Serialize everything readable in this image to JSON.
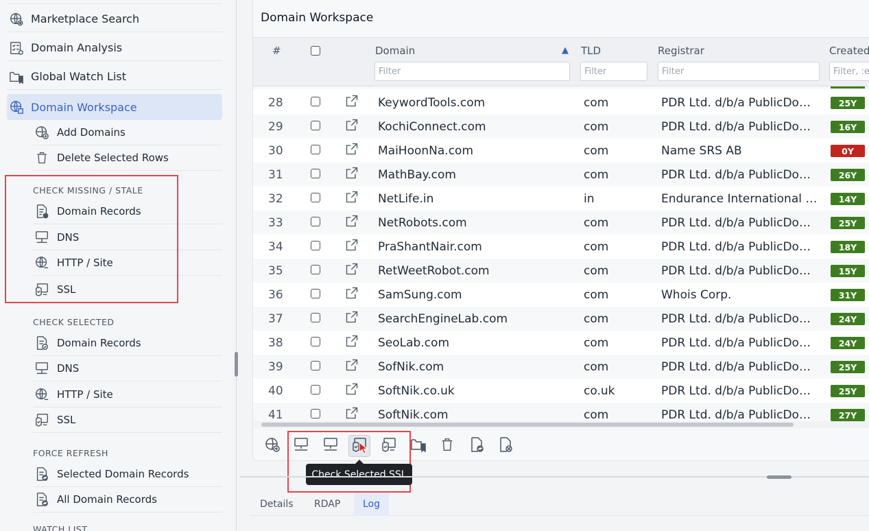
{
  "sidebar": {
    "top_items": [
      {
        "label": "Marketplace Search",
        "icon": "globe-gear-icon"
      },
      {
        "label": "Domain Analysis",
        "icon": "checklist-icon"
      },
      {
        "label": "Global Watch List",
        "icon": "folder-bookmark-icon"
      },
      {
        "label": "Domain Workspace",
        "icon": "globe-grid-icon",
        "active": true
      }
    ],
    "workspace_items": [
      {
        "label": "Add Domains",
        "icon": "globe-plus-icon"
      },
      {
        "label": "Delete Selected Rows",
        "icon": "trash-icon"
      }
    ],
    "check_missing": {
      "heading": "CHECK MISSING / STALE",
      "items": [
        {
          "label": "Domain Records",
          "icon": "document-badge-icon"
        },
        {
          "label": "DNS",
          "icon": "network-icon"
        },
        {
          "label": "HTTP / Site",
          "icon": "globe-link-icon"
        },
        {
          "label": "SSL",
          "icon": "certificate-shield-icon"
        }
      ]
    },
    "check_selected": {
      "heading": "CHECK SELECTED",
      "items": [
        {
          "label": "Domain Records",
          "icon": "document-check-icon"
        },
        {
          "label": "DNS",
          "icon": "network-icon"
        },
        {
          "label": "HTTP / Site",
          "icon": "globe-link-icon"
        },
        {
          "label": "SSL",
          "icon": "certificate-shield-icon"
        }
      ]
    },
    "force_refresh": {
      "heading": "FORCE REFRESH",
      "items": [
        {
          "label": "Selected Domain Records",
          "icon": "document-refresh-icon"
        },
        {
          "label": "All Domain Records",
          "icon": "document-refresh-icon"
        }
      ]
    },
    "next_heading": "WATCH LIST"
  },
  "workspace": {
    "title": "Domain Workspace",
    "columns": {
      "num": "#",
      "domain": "Domain",
      "sort_indicator": "▲",
      "tld": "TLD",
      "registrar": "Registrar",
      "created": "Created"
    },
    "filters": {
      "domain": "Filter",
      "tld": "Filter",
      "registrar": "Filter",
      "created": "Filter, :e"
    },
    "rows": [
      {
        "num": "28",
        "domain": "KeywordTools.com",
        "tld": "com",
        "registrar": "PDR Ltd. d/b/a PublicDomainRegistry.com",
        "age": "25Y",
        "age_color": "#3e7d1f"
      },
      {
        "num": "29",
        "domain": "KochiConnect.com",
        "tld": "com",
        "registrar": "PDR Ltd. d/b/a PublicDomainRegistry.com",
        "age": "16Y",
        "age_color": "#3e7d1f"
      },
      {
        "num": "30",
        "domain": "MaiHoonNa.com",
        "tld": "com",
        "registrar": "Name SRS AB",
        "age": "0Y",
        "age_color": "#c0261d"
      },
      {
        "num": "31",
        "domain": "MathBay.com",
        "tld": "com",
        "registrar": "PDR Ltd. d/b/a PublicDomainRegistry.com",
        "age": "26Y",
        "age_color": "#3e7d1f"
      },
      {
        "num": "32",
        "domain": "NetLife.in",
        "tld": "in",
        "registrar": "Endurance International Group",
        "age": "14Y",
        "age_color": "#3e7d1f"
      },
      {
        "num": "33",
        "domain": "NetRobots.com",
        "tld": "com",
        "registrar": "PDR Ltd. d/b/a PublicDomainRegistry.com",
        "age": "25Y",
        "age_color": "#3e7d1f"
      },
      {
        "num": "34",
        "domain": "PraShantNair.com",
        "tld": "com",
        "registrar": "PDR Ltd. d/b/a PublicDomainRegistry.com",
        "age": "18Y",
        "age_color": "#3e7d1f"
      },
      {
        "num": "35",
        "domain": "RetWeetRobot.com",
        "tld": "com",
        "registrar": "PDR Ltd. d/b/a PublicDomainRegistry.com",
        "age": "15Y",
        "age_color": "#3e7d1f"
      },
      {
        "num": "36",
        "domain": "SamSung.com",
        "tld": "com",
        "registrar": "Whois Corp.",
        "age": "31Y",
        "age_color": "#3e7d1f"
      },
      {
        "num": "37",
        "domain": "SearchEngineLab.com",
        "tld": "com",
        "registrar": "PDR Ltd. d/b/a PublicDomainRegistry.com",
        "age": "24Y",
        "age_color": "#3e7d1f"
      },
      {
        "num": "38",
        "domain": "SeoLab.com",
        "tld": "com",
        "registrar": "PDR Ltd. d/b/a PublicDomainRegistry.com",
        "age": "24Y",
        "age_color": "#3e7d1f"
      },
      {
        "num": "39",
        "domain": "SofNik.com",
        "tld": "com",
        "registrar": "PDR Ltd. d/b/a PublicDomainRegistry.com",
        "age": "25Y",
        "age_color": "#3e7d1f"
      },
      {
        "num": "40",
        "domain": "SoftNik.co.uk",
        "tld": "co.uk",
        "registrar": "PDR Ltd. d/b/a PublicDomainRegistry.com",
        "age": "25Y",
        "age_color": "#3e7d1f"
      },
      {
        "num": "41",
        "domain": "SoftNik.com",
        "tld": "com",
        "registrar": "PDR Ltd. d/b/a PublicDomainRegistry.com",
        "age": "27Y",
        "age_color": "#3e7d1f"
      }
    ],
    "toolbar": [
      {
        "name": "add-domains-button",
        "icon": "globe-plus-icon"
      },
      {
        "name": "check-missing-dns-button",
        "icon": "network-icon"
      },
      {
        "name": "check-selected-dns-button",
        "icon": "network-icon"
      },
      {
        "name": "check-selected-ssl-button",
        "icon": "certificate-shield-icon",
        "hover": true
      },
      {
        "name": "check-missing-ssl-button",
        "icon": "certificate-shield-icon"
      },
      {
        "name": "watch-list-button",
        "icon": "folder-bookmark-icon"
      },
      {
        "name": "delete-rows-button",
        "icon": "trash-icon"
      },
      {
        "name": "refresh-selected-button",
        "icon": "document-refresh-icon"
      },
      {
        "name": "refresh-all-button",
        "icon": "document-refresh-icon"
      }
    ],
    "tooltip": "Check Selected SSL"
  },
  "bottom_tabs": [
    {
      "label": "Details"
    },
    {
      "label": "RDAP"
    },
    {
      "label": "Log",
      "active": true
    }
  ],
  "colors": {
    "accent": "#3a62c2",
    "age_good": "#3e7d1f",
    "age_bad": "#c0261d",
    "highlight_box": "#e0474c"
  }
}
